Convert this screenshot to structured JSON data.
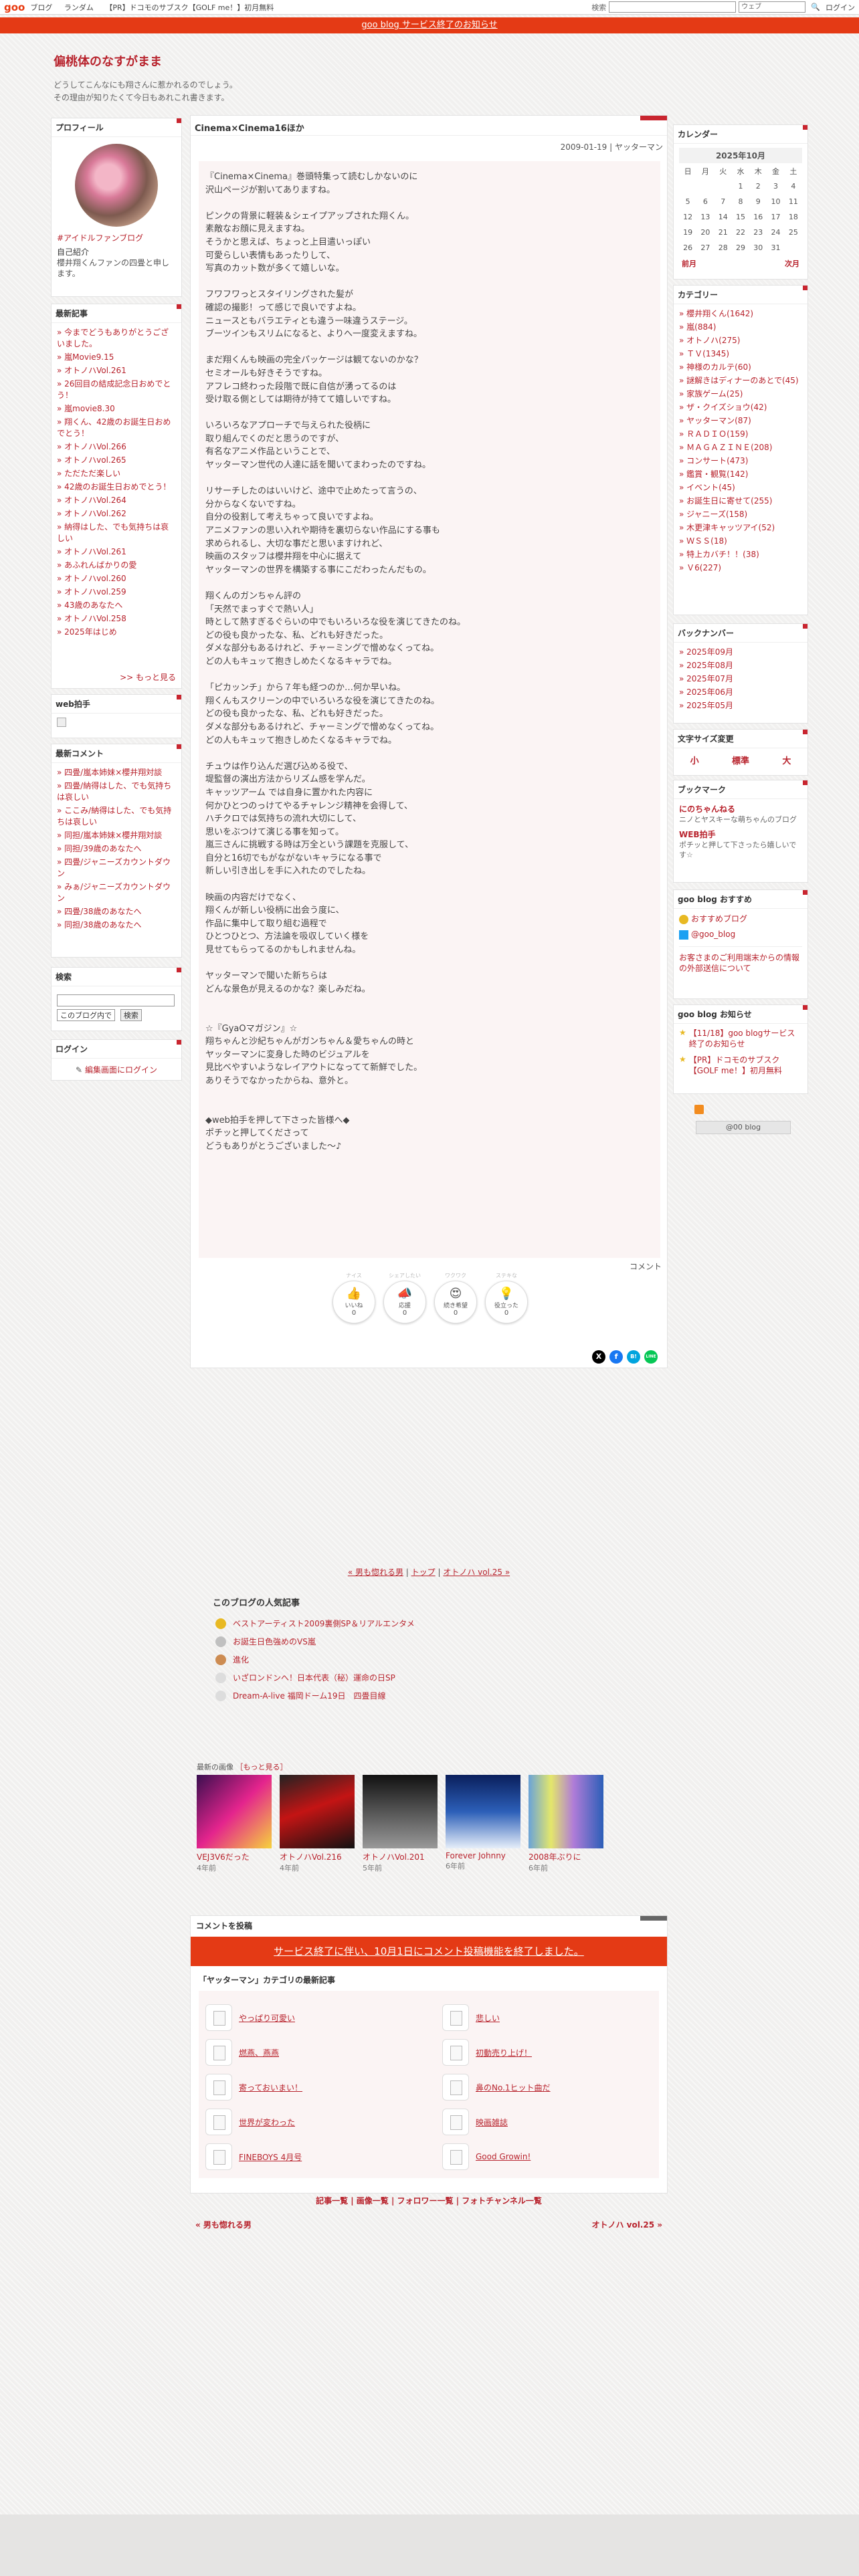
{
  "topbar": {
    "logo": "goo",
    "links": [
      "ブログ",
      "ランダム",
      "【PR】ドコモのサブスク【GOLF me！】初月無料"
    ],
    "search_label": "検索",
    "search_scope": "ウェブ",
    "login": "ログイン"
  },
  "notice": "goo blog サービス終了のお知らせ",
  "blog": {
    "title": "偏桃体のなすがまま",
    "description": "どうしてこんなにも翔さんに惹かれるのでしょう。\nその理由が知りたくて今日もあれこれ書きます。"
  },
  "profile": {
    "title": "プロフィール",
    "tag": "#アイドルファンブログ",
    "intro_label": "自己紹介",
    "intro": "櫻井翔くんファンの四畳と申します。"
  },
  "recent_posts": {
    "title": "最新記事",
    "items": [
      "今までどうもありがとうございました。",
      "嵐Movie9.15",
      "オトノハVol.261",
      "26回目の結成記念日おめでとう！",
      "嵐movie8.30",
      "翔くん、42歳のお誕生日おめでとう！",
      "オトノハVol.266",
      "オトノハvol.265",
      "ただただ楽しい",
      "42歳のお誕生日おめでとう！",
      "オトノハVol.264",
      "オトノハVol.262",
      "納得はした、でも気持ちは哀しい",
      "オトノハVol.261",
      "あふれんばかりの愛",
      "オトノハvol.260",
      "オトノハvol.259",
      "43歳のあなたへ",
      "オトノハVol.258",
      "2025年はじめ"
    ],
    "more": ">> もっと見る"
  },
  "web_clap": {
    "title": "web拍手"
  },
  "recent_comments": {
    "title": "最新コメント",
    "items": [
      "四畳/嵐本姉妹×櫻井翔対談",
      "四畳/納得はした、でも気持ちは哀しい",
      "ここみ/納得はした、でも気持ちは哀しい",
      "同担/嵐本姉妹×櫻井翔対談",
      "同担/39歳のあなたへ",
      "四畳/ジャニーズカウントダウン",
      "みぁ/ジャニーズカウントダウン",
      "四畳/38歳のあなたへ",
      "同担/38歳のあなたへ"
    ]
  },
  "search": {
    "title": "検索",
    "scope": "このブログ内で",
    "button": "検索"
  },
  "login_box": {
    "title": "ログイン",
    "link": "編集画面にログイン"
  },
  "article": {
    "title": "Cinema×Cinema16ほか",
    "meta": "2009-01-19 | ヤッターマン",
    "body": "『Cinema×Cinema』巻頭特集って読むしかないのに\n沢山ページが割いてありますね。\n\nピンクの背景に軽装＆シェイプアップされた翔くん。\n素敵なお顔に見えますね。\nそうかと思えば、ちょっと上目遣いっぽい\n可愛らしい表情もあったりして、\n写真のカット数が多くて嬉しいな。\n\nフワフワっとスタイリングされた髪が\n確認の撮影！って感じで良いですよね。\nニュースともバラエティとも違う一味違うステージ。\nブーツインもスリムになると、よりへ一度変えますね。\n\nまだ翔くんも映画の完全パッケージは観てないのかな？\nセミオールも好きそうですね。\nアフレコ終わった段階で既に自信が湧ってるのは\n受け取る側としては期待が持てて嬉しいですね。\n\nいろいろなアプローチで与えられた役柄に\n取り組んでくのだと思うのですが、\n有名なアニメ作品ということで、\nヤッターマン世代の人達に話を聞いてまわったのですね。\n\nリサーチしたのはいいけど、途中で止めたって言うの、\n分からなくないですね。\n自分の役割して考えちゃって良いですよね。\nアニメファンの思い入れや期待を裏切らない作品にする事も\n求められるし、大切な事だと思いますけれど、\n映画のスタッフは櫻井翔を中心に据えて\nヤッターマンの世界を構築する事にこだわったんだもの。\n\n翔くんのガンちゃん評の\n「天然でまっすぐで熱い人」\n時として熱すぎるぐらいの中でもいろいろな役を演じてきたのね。\nどの役も良かったな、私、どれも好きだった。\nダメな部分もあるけれど、チャーミングで憎めなくってね。\nどの人もキュッて抱きしめたくなるキャラでね。\n\n「ピカッンチ」から７年も経つのか…何か早いね。\n翔くんもスクリーンの中でいろいろな役を演じてきたのね。\nどの役も良かったな、私、どれも好きだった。\nダメな部分もあるけれど、チャーミングで憎めなくってね。\nどの人もキュッて抱きしめたくなるキャラでね。\n\nチュウは作り込んだ選び込める役で、\n堤監督の演出方法からリズム感を学んだ。\nキャッツアーム では自身に置かれた内容に\n何かひとつのっけてやるチャレンジ精神を会得して、\nハチクロでは気持ちの流れ大切にして、\n思いをぶつけて演じる事を知って。\n嵐三さんに挑戦する時は万全という課題を克服して、\n自分と16切でもがながないキャラになる事で\n新しい引き出しを手に入れたのでしたね。\n\n映画の内容だけでなく、\n翔くんが新しい役柄に出会う度に、\n作品に集中して取り組む過程で\nひとつひとつ、方法論を吸収していく様を\n見せてもらってるのかもしれませんね。\n\nヤッターマンで聞いた新ちらは\nどんな景色が見えるのかな？楽しみだね。\n\n\n☆『GyaOマガジン』☆\n翔ちゃんと沙紀ちゃんがガンちゃん＆愛ちゃんの時と\nヤッターマンに変身した時のビジュアルを\n見比べやすいようなレイアウトになってて新鮮でした。\nありそうでなかったからね、意外と。\n\n\n◆web拍手を押して下さった皆様へ◆\nポチッと押してくださって\nどうもありがとうございました〜♪",
    "comment_label": "コメント"
  },
  "reactions": [
    {
      "caption": "ナイス",
      "emoji": "👍",
      "label": "いいね",
      "count": "0"
    },
    {
      "caption": "シェアしたい",
      "emoji": "📣",
      "label": "応援",
      "count": "0"
    },
    {
      "caption": "ワクワク",
      "emoji": "😍",
      "label": "続き希望",
      "count": "0"
    },
    {
      "caption": "ステキな",
      "emoji": "💡",
      "label": "役立った",
      "count": "0"
    }
  ],
  "share_icons": [
    "X",
    "f",
    "B!",
    "LINE"
  ],
  "pager": {
    "prev": "« 男も惚れる男",
    "top": "トップ",
    "next": "オトノハ vol.25 »"
  },
  "popular": {
    "title": "このブログの人気記事",
    "items": [
      "ベストアーティスト2009裏側SP＆リアルエンタメ",
      "お誕生日色強めのVS嵐",
      "進化",
      "いざロンドンへ！日本代表（秘）運命の日SP",
      "Dream-A-live 福岡ドーム19日　四畳目線"
    ]
  },
  "recent_images": {
    "title": "最新の画像",
    "more": "［もっと見る］",
    "items": [
      {
        "caption": "VEJ3V6だった",
        "ago": "4年前"
      },
      {
        "caption": "オトノハVol.216",
        "ago": "4年前"
      },
      {
        "caption": "オトノハVol.201",
        "ago": "5年前"
      },
      {
        "caption": "Forever Johnny",
        "ago": "6年前"
      },
      {
        "caption": "2008年ぶりに",
        "ago": "6年前"
      }
    ]
  },
  "comment_post": {
    "title": "コメントを投稿",
    "notice": "サービス終了に伴い、10月1日にコメント投稿機能を終了しました。"
  },
  "category_latest": {
    "title": "「ヤッターマン」カテゴリの最新記事",
    "items": [
      "やっぱり可愛い",
      "悲しい",
      "燃燕、燕燕",
      "初動売り上げ！",
      "寄っておいまい！",
      "鼻のNo.1ヒット曲だ",
      "世界が変わった",
      "映画雑誌",
      "FINEBOYS 4月号",
      "Good Growin!"
    ]
  },
  "footer": {
    "links": "記事一覧 | 画像一覧 | フォロワー一覧 | フォトチャンネル一覧",
    "prev": "« 男も惚れる男",
    "next": "オトノハ vol.25 »"
  },
  "calendar": {
    "title": "カレンダー",
    "month": "2025年10月",
    "weekdays": [
      "日",
      "月",
      "火",
      "水",
      "木",
      "金",
      "土"
    ],
    "weeks": [
      [
        "",
        "",
        "",
        "1",
        "2",
        "3",
        "4"
      ],
      [
        "5",
        "6",
        "7",
        "8",
        "9",
        "10",
        "11"
      ],
      [
        "12",
        "13",
        "14",
        "15",
        "16",
        "17",
        "18"
      ],
      [
        "19",
        "20",
        "21",
        "22",
        "23",
        "24",
        "25"
      ],
      [
        "26",
        "27",
        "28",
        "29",
        "30",
        "31",
        ""
      ]
    ],
    "prev": "前月",
    "next": "次月"
  },
  "categories": {
    "title": "カテゴリー",
    "items": [
      "櫻井翔くん(1642)",
      "嵐(884)",
      "オトノハ(275)",
      "ＴＶ(1345)",
      "神様のカルテ(60)",
      "謎解きはディナーのあとで(45)",
      "家族ゲーム(25)",
      "ザ・クイズショウ(42)",
      "ヤッターマン(87)",
      "ＲＡＤＩＯ(159)",
      "ＭＡＧＡＺＩＮＥ(208)",
      "コンサート(473)",
      "鑑賞・観覧(142)",
      "イベント(45)",
      "お誕生日に寄せて(255)",
      "ジャニーズ(158)",
      "木更津キャッツアイ(52)",
      "ＷＳＳ(18)",
      "特上カバチ！！(38)",
      "Ｖ6(227)"
    ]
  },
  "backnumber": {
    "title": "バックナンバー",
    "items": [
      "2025年09月",
      "2025年08月",
      "2025年07月",
      "2025年06月",
      "2025年05月"
    ]
  },
  "font_size": {
    "title": "文字サイズ変更",
    "options": [
      "小",
      "標準",
      "大"
    ]
  },
  "bookmarks": {
    "title": "ブックマーク",
    "items": [
      {
        "name": "にのちゃんねる",
        "desc": "ニノとヤスキーな萌ちゃんのブログ"
      },
      {
        "name": "WEB拍手",
        "desc": "ポチッと押して下さったら嬉しいです☆"
      }
    ]
  },
  "goo_recommend": {
    "title": "goo blog おすすめ",
    "items": [
      "おすすめブログ",
      "@goo_blog"
    ],
    "notice": "お客さまのご利用端末からの情報の外部送信について"
  },
  "goo_notice": {
    "title": "goo blog お知らせ",
    "items": [
      "【11/18】goo blogサービス終了のお知らせ",
      "【PR】ドコモのサブスク【GOLF me！】初月無料"
    ]
  },
  "goo_badge": "@00 blog",
  "colors": {
    "accent": "#b8232d",
    "banner": "#e43a15",
    "bg": "#f1f0ef"
  }
}
